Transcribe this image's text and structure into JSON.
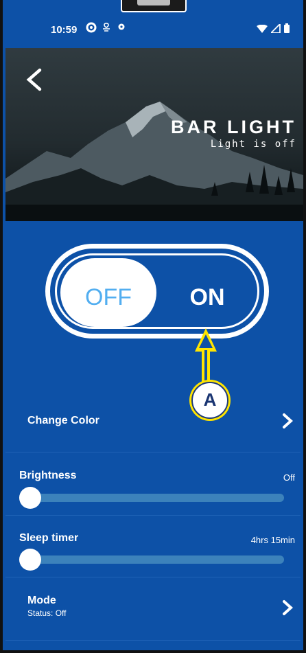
{
  "status_bar": {
    "time": "10:59",
    "icons": [
      "circle-status-icon",
      "fan-icon",
      "gear-status-icon",
      "wifi-icon",
      "signal-icon",
      "battery-icon"
    ]
  },
  "header": {
    "title": "BAR LIGHT",
    "subtitle": "Light is off"
  },
  "power_toggle": {
    "off_label": "OFF",
    "on_label": "ON",
    "state": "off"
  },
  "annotation": {
    "label": "A",
    "color": "#ffe500"
  },
  "settings": {
    "change_color_label": "Change Color",
    "brightness": {
      "label": "Brightness",
      "value": "Off",
      "level": 0
    },
    "sleep_timer": {
      "label": "Sleep timer",
      "value": "4hrs 15min",
      "level": 0
    },
    "mode": {
      "label": "Mode",
      "status": "Status: Off"
    }
  },
  "colors": {
    "background": "#0d51a7",
    "track": "#3c82bb",
    "off_text": "#52aef0"
  }
}
